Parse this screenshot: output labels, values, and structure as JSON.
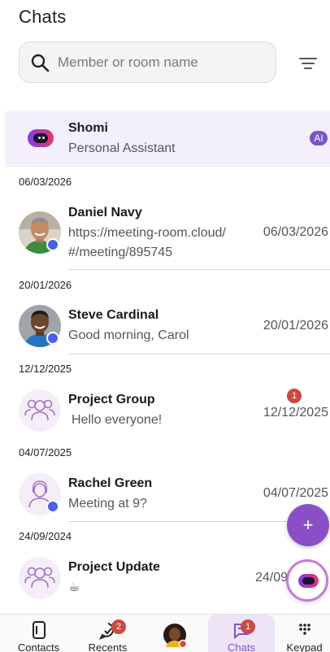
{
  "header": {
    "title": "Chats"
  },
  "search": {
    "placeholder": "Member or room name"
  },
  "assistant": {
    "name": "Shomi",
    "subtitle": "Personal Assistant",
    "badge": "AI"
  },
  "chats": [
    {
      "date_header": "06/03/2026",
      "name": "Daniel Navy",
      "message_line1": "https://meeting-room.cloud/",
      "message_line2": "#/meeting/895745",
      "time": "06/03/2026"
    },
    {
      "date_header": "20/01/2026",
      "name": "Steve Cardinal",
      "message": "Good morning, Carol",
      "time": "20/01/2026"
    },
    {
      "date_header": "12/12/2025",
      "name": "Project Group",
      "message": "Hello everyone!",
      "time": "12/12/2025",
      "unread": "1"
    },
    {
      "date_header": "04/07/2025",
      "name": "Rachel Green",
      "message": "Meeting at 9?",
      "time": "04/07/2025"
    },
    {
      "date_header": "24/09/2024",
      "name": "Project Update",
      "message": "☕",
      "time": "24/09"
    }
  ],
  "fab": {
    "add_label": "+"
  },
  "tabs": [
    {
      "label": "Contacts"
    },
    {
      "label": "Recents",
      "badge": "2"
    },
    {
      "label": ""
    },
    {
      "label": "Chats",
      "badge": "1"
    },
    {
      "label": "Keypad"
    }
  ],
  "colors": {
    "accent": "#7a55c8",
    "badge_red": "#c94a44",
    "status_blue": "#4d5fe6",
    "ai_bg": "#f4f0fb"
  }
}
